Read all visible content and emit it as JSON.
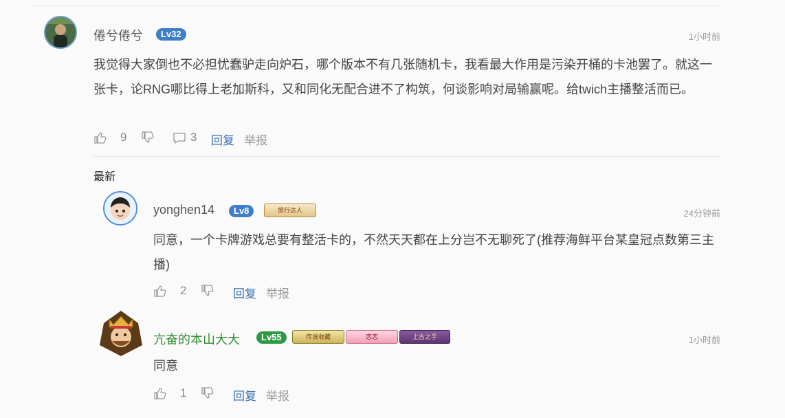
{
  "comment": {
    "author": "倦兮倦兮",
    "level": "Lv32",
    "time": "1小时前",
    "text": "我觉得大家倒也不必担忧蠢驴走向炉石，哪个版本不有几张随机卡，我看最大作用是污染开桶的卡池罢了。就这一张卡，论RNG哪比得上老加斯科，又和同化无配合进不了构筑，何谈影响对局输赢呢。给twich主播整活而已。",
    "likes": "9",
    "replies_count": "3",
    "reply_label": "回复",
    "report_label": "举报"
  },
  "replies_section": {
    "title": "最新"
  },
  "replies": [
    {
      "author": "yonghen14",
      "level": "Lv8",
      "badges": [
        "旅行达人"
      ],
      "time": "24分钟前",
      "text": "同意，一个卡牌游戏总要有整活卡的，不然天天都在上分岂不无聊死了(推荐海鲜平台某皇冠点数第三主播)",
      "likes": "2",
      "reply_label": "回复",
      "report_label": "举报"
    },
    {
      "author": "亢奋的本山大大",
      "level": "Lv55",
      "badges": [
        "传说收藏",
        "恋恋",
        "上古之手"
      ],
      "time": "1小时前",
      "text": "同意",
      "likes": "1",
      "reply_label": "回复",
      "report_label": "举报"
    }
  ],
  "colors": {
    "level_blue": "#3f7fc8",
    "level_green": "#2f9a44",
    "link_blue": "#3b6fb6"
  }
}
